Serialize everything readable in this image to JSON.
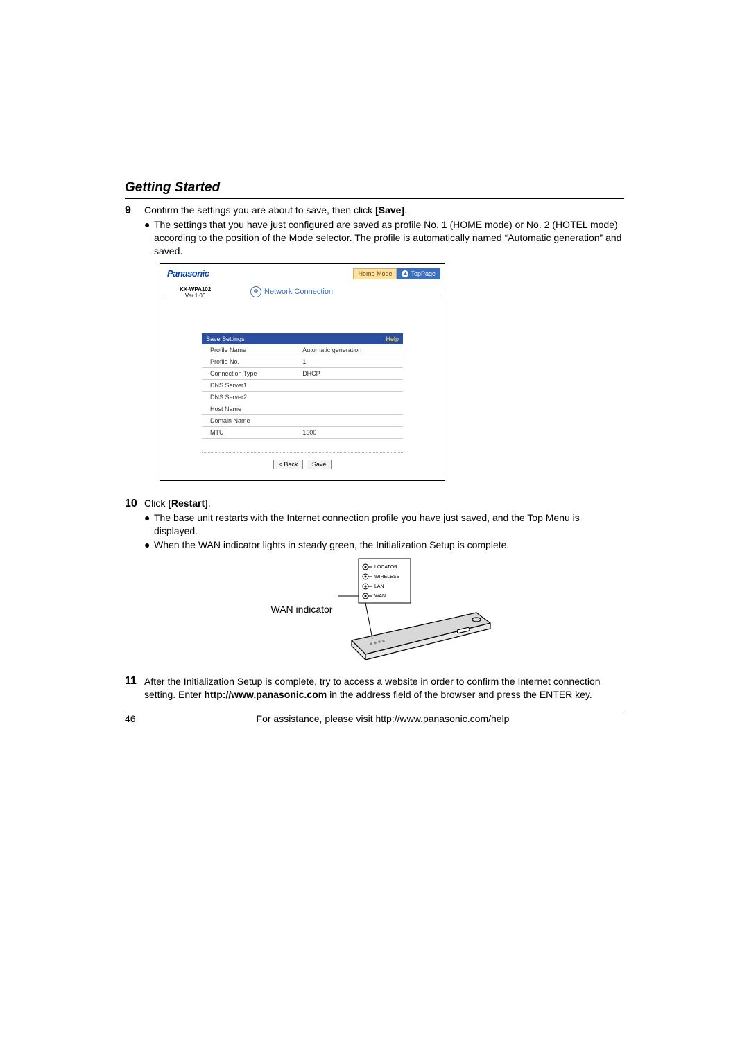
{
  "section_title": "Getting Started",
  "step9": {
    "num": "9",
    "text_pre": "Confirm the settings you are about to save, then click ",
    "text_bold": "[Save]",
    "text_post": ".",
    "bullet1": "The settings that you have just configured are saved as profile No. 1 (HOME mode) or No. 2 (HOTEL mode) according to the position of the Mode selector. The profile is automatically named “Automatic generation” and saved."
  },
  "screenshot": {
    "brand": "Panasonic",
    "mode_left": "Home Mode",
    "mode_right": "TopPage",
    "model": "KX-WPA102",
    "version": "Ver.1.00",
    "net_title": "Network Connection",
    "table_title": "Save Settings",
    "help": "Help",
    "rows": [
      {
        "label": "Profile Name",
        "value": "Automatic generation"
      },
      {
        "label": "Profile No.",
        "value": "1"
      },
      {
        "label": "Connection Type",
        "value": "DHCP"
      },
      {
        "label": "DNS Server1",
        "value": ""
      },
      {
        "label": "DNS Server2",
        "value": ""
      },
      {
        "label": "Host Name",
        "value": ""
      },
      {
        "label": "Domain Name",
        "value": ""
      },
      {
        "label": "MTU",
        "value": "1500"
      }
    ],
    "btn_back": "< Back",
    "btn_save": "Save"
  },
  "step10": {
    "num": "10",
    "text_pre": "Click ",
    "text_bold": "[Restart]",
    "text_post": ".",
    "bullet1": "The base unit restarts with the Internet connection profile you have just saved, and the Top Menu is displayed.",
    "bullet2": "When the WAN indicator lights in steady green, the Initialization Setup is complete."
  },
  "diagram": {
    "wan_label": "WAN indicator",
    "led_labels": [
      "LOCATOR",
      "WIRELESS",
      "LAN",
      "WAN"
    ]
  },
  "step11": {
    "num": "11",
    "text_pre": "After the Initialization Setup is complete, try to access a website in order to confirm the Internet connection setting. Enter ",
    "text_bold": "http://www.panasonic.com",
    "text_post": " in the address field of the browser and press the ENTER key."
  },
  "footer": {
    "page": "46",
    "text": "For assistance, please visit http://www.panasonic.com/help"
  }
}
